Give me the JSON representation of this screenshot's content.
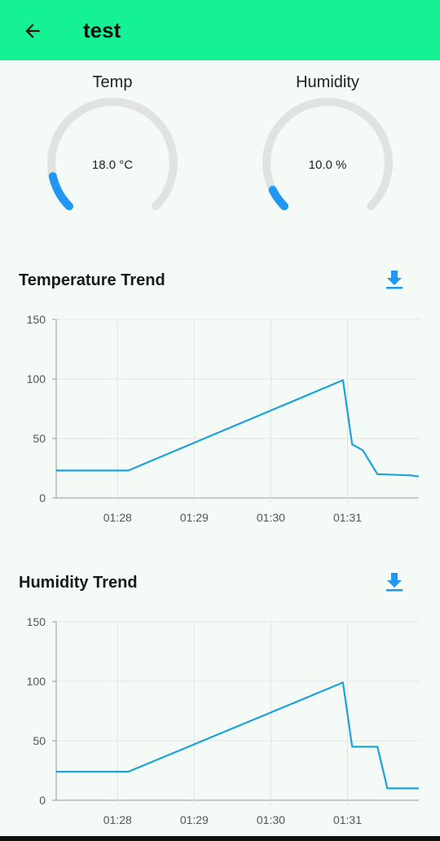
{
  "header": {
    "title": "test",
    "back_icon": "arrow-left-icon"
  },
  "gauges": [
    {
      "label": "Temp",
      "value_text": "18.0 °C",
      "fraction": 0.12,
      "track_color": "#e0e3e0",
      "fill_color": "#2196f3"
    },
    {
      "label": "Humidity",
      "value_text": "10.0 %",
      "fraction": 0.07,
      "track_color": "#e0e3e0",
      "fill_color": "#2196f3"
    }
  ],
  "temperature_section": {
    "title": "Temperature Trend",
    "download_icon": "download-icon"
  },
  "humidity_section": {
    "title": "Humidity Trend",
    "download_icon": "download-icon"
  },
  "colors": {
    "accent": "#15f294",
    "line": "#1aa3d9",
    "download": "#2196f3"
  },
  "chart_data": [
    {
      "type": "line",
      "title": "Temperature Trend",
      "xlabel": "",
      "ylabel": "",
      "x_ticks": [
        "01:28",
        "01:29",
        "01:30",
        "01:31"
      ],
      "x_tick_minutes": [
        0,
        1,
        2,
        3
      ],
      "xlim_minutes": [
        -0.8,
        3.93
      ],
      "ylim": [
        0,
        150
      ],
      "y_ticks": [
        0,
        50,
        100,
        150
      ],
      "grid": true,
      "series": [
        {
          "x_minutes": [
            -0.8,
            0.14,
            2.94,
            3.06,
            3.2,
            3.39,
            3.83,
            3.93
          ],
          "values": [
            23,
            23,
            99,
            45,
            40,
            20,
            19,
            18
          ]
        }
      ]
    },
    {
      "type": "line",
      "title": "Humidity Trend",
      "xlabel": "",
      "ylabel": "",
      "x_ticks": [
        "01:28",
        "01:29",
        "01:30",
        "01:31"
      ],
      "x_tick_minutes": [
        0,
        1,
        2,
        3
      ],
      "xlim_minutes": [
        -0.8,
        3.93
      ],
      "ylim": [
        0,
        150
      ],
      "y_ticks": [
        0,
        50,
        100,
        150
      ],
      "grid": true,
      "series": [
        {
          "x_minutes": [
            -0.8,
            0.14,
            2.94,
            3.06,
            3.39,
            3.52,
            3.93
          ],
          "values": [
            24,
            24,
            99,
            45,
            45,
            10,
            10
          ]
        }
      ]
    }
  ]
}
